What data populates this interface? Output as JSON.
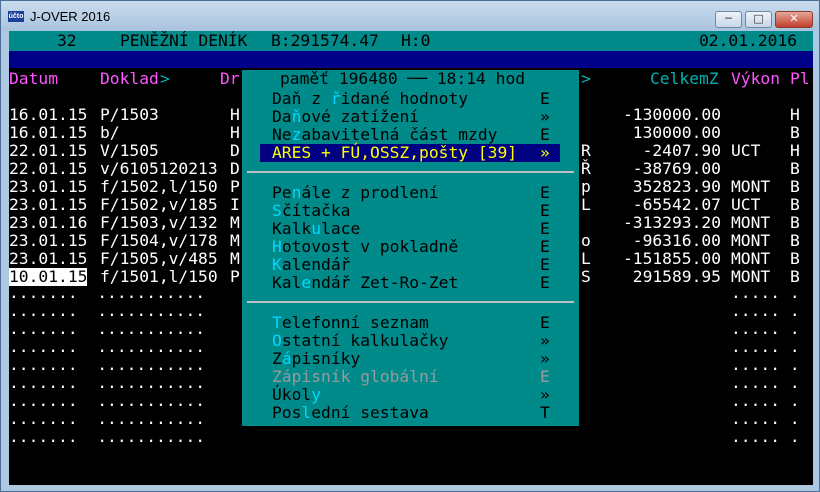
{
  "window": {
    "title": "J-OVER 2016",
    "icon_label": "účto",
    "buttons": {
      "minimize": "─",
      "maximize": "□",
      "close": "✕"
    }
  },
  "status_bar": {
    "number": "32",
    "module": "PENĚŽNÍ DENÍK",
    "balance": "B:291574.47",
    "h": "H:0",
    "date": "02.01.2016"
  },
  "columns": {
    "datum": "Datum",
    "doklad": "Doklad",
    "doklad_arrow": ">",
    "dr": "Dr",
    "right_arrow": ">",
    "celkem": "CelkemZ",
    "vykon": "Výkon",
    "pl": "Pl"
  },
  "rows": [
    {
      "date": "16.01.15",
      "doc": "P/1503",
      "c": "H",
      "m": "",
      "amount": "-130000.00",
      "vykon": "",
      "pl": "H"
    },
    {
      "date": "16.01.15",
      "doc": "b/",
      "c": "H",
      "m": "",
      "amount": "130000.00",
      "vykon": "",
      "pl": "B"
    },
    {
      "date": "22.01.15",
      "doc": "V/1505",
      "c": "D",
      "m": "R",
      "amount": "-2407.90",
      "vykon": "UCT",
      "pl": "H"
    },
    {
      "date": "22.01.15",
      "doc": "v/6105120213",
      "c": "D",
      "m": "Ř",
      "amount": "-38769.00",
      "vykon": "",
      "pl": "B"
    },
    {
      "date": "23.01.15",
      "doc": "f/1502,l/150",
      "c": "P",
      "m": "p",
      "amount": "352823.90",
      "vykon": "MONT",
      "pl": "B"
    },
    {
      "date": "23.01.15",
      "doc": "F/1502,v/185",
      "c": "I",
      "m": "L",
      "amount": "-65542.07",
      "vykon": "UCT",
      "pl": "B"
    },
    {
      "date": "23.01.16",
      "doc": "F/1503,v/132",
      "c": "M",
      "m": "",
      "amount": "-313293.20",
      "vykon": "MONT",
      "pl": "B"
    },
    {
      "date": "23.01.15",
      "doc": "F/1504,v/178",
      "c": "M",
      "m": "o",
      "amount": "-96316.00",
      "vykon": "MONT",
      "pl": "B"
    },
    {
      "date": "23.01.15",
      "doc": "F/1505,v/485",
      "c": "M",
      "m": "L",
      "amount": "-151855.00",
      "vykon": "MONT",
      "pl": "B"
    },
    {
      "date": "10.01.15",
      "doc": "f/1501,l/150",
      "c": "P",
      "m": "S",
      "amount": "291589.95",
      "vykon": "MONT",
      "pl": "B"
    }
  ],
  "dotted": {
    "left": ".......  ...........",
    "right": "..... ."
  },
  "menu": {
    "header": "paměť 196480 ── 18:14 hod",
    "groups": [
      [
        {
          "pre": "Daň z ",
          "hk": "ř",
          "post": "idané hodnoty",
          "mark": "E",
          "state": "normal"
        },
        {
          "pre": "Da",
          "hk": "ň",
          "post": "ové zatížení",
          "mark": "»",
          "state": "normal"
        },
        {
          "pre": "Ne",
          "hk": "z",
          "post": "abavitelná část mzdy",
          "mark": "E",
          "state": "normal"
        },
        {
          "pre": "ARES + FÚ,OSSZ,pošty [39]",
          "hk": "",
          "post": "",
          "mark": "»",
          "state": "selected"
        }
      ],
      [
        {
          "pre": "Pe",
          "hk": "n",
          "post": "ále z prodlení",
          "mark": "E",
          "state": "normal"
        },
        {
          "pre": "",
          "hk": "S",
          "post": "čítačka",
          "mark": "E",
          "state": "normal"
        },
        {
          "pre": "Kalk",
          "hk": "u",
          "post": "lace",
          "mark": "E",
          "state": "normal"
        },
        {
          "pre": "",
          "hk": "H",
          "post": "otovost v pokladně",
          "mark": "E",
          "state": "normal"
        },
        {
          "pre": "",
          "hk": "K",
          "post": "alendář",
          "mark": "E",
          "state": "normal"
        },
        {
          "pre": "Kal",
          "hk": "e",
          "post": "ndář Zet-Ro-Zet",
          "mark": "E",
          "state": "normal"
        }
      ],
      [
        {
          "pre": "",
          "hk": "T",
          "post": "elefonní seznam",
          "mark": "E",
          "state": "normal"
        },
        {
          "pre": "",
          "hk": "O",
          "post": "statní kalkulačky",
          "mark": "»",
          "state": "normal"
        },
        {
          "pre": "Z",
          "hk": "á",
          "post": "pisníky",
          "mark": "»",
          "state": "normal"
        },
        {
          "pre": "Zápisník globální",
          "hk": "",
          "post": "",
          "mark": "E",
          "state": "disabled"
        },
        {
          "pre": "Úkol",
          "hk": "y",
          "post": "",
          "mark": "»",
          "state": "normal"
        },
        {
          "pre": "Pos",
          "hk": "l",
          "post": "ední sestava",
          "mark": "T",
          "state": "normal"
        }
      ]
    ]
  },
  "colors": {
    "terminal_bg": "#000000",
    "header_bar": "#008a8a",
    "blue_bar": "#000088",
    "menu_bg": "#008a8a",
    "menu_selected": "#000080",
    "menu_selected_text": "#ffff00",
    "hotkey": "#00d7ff",
    "disabled": "#9a9a9a",
    "magenta": "#ff55ff"
  }
}
